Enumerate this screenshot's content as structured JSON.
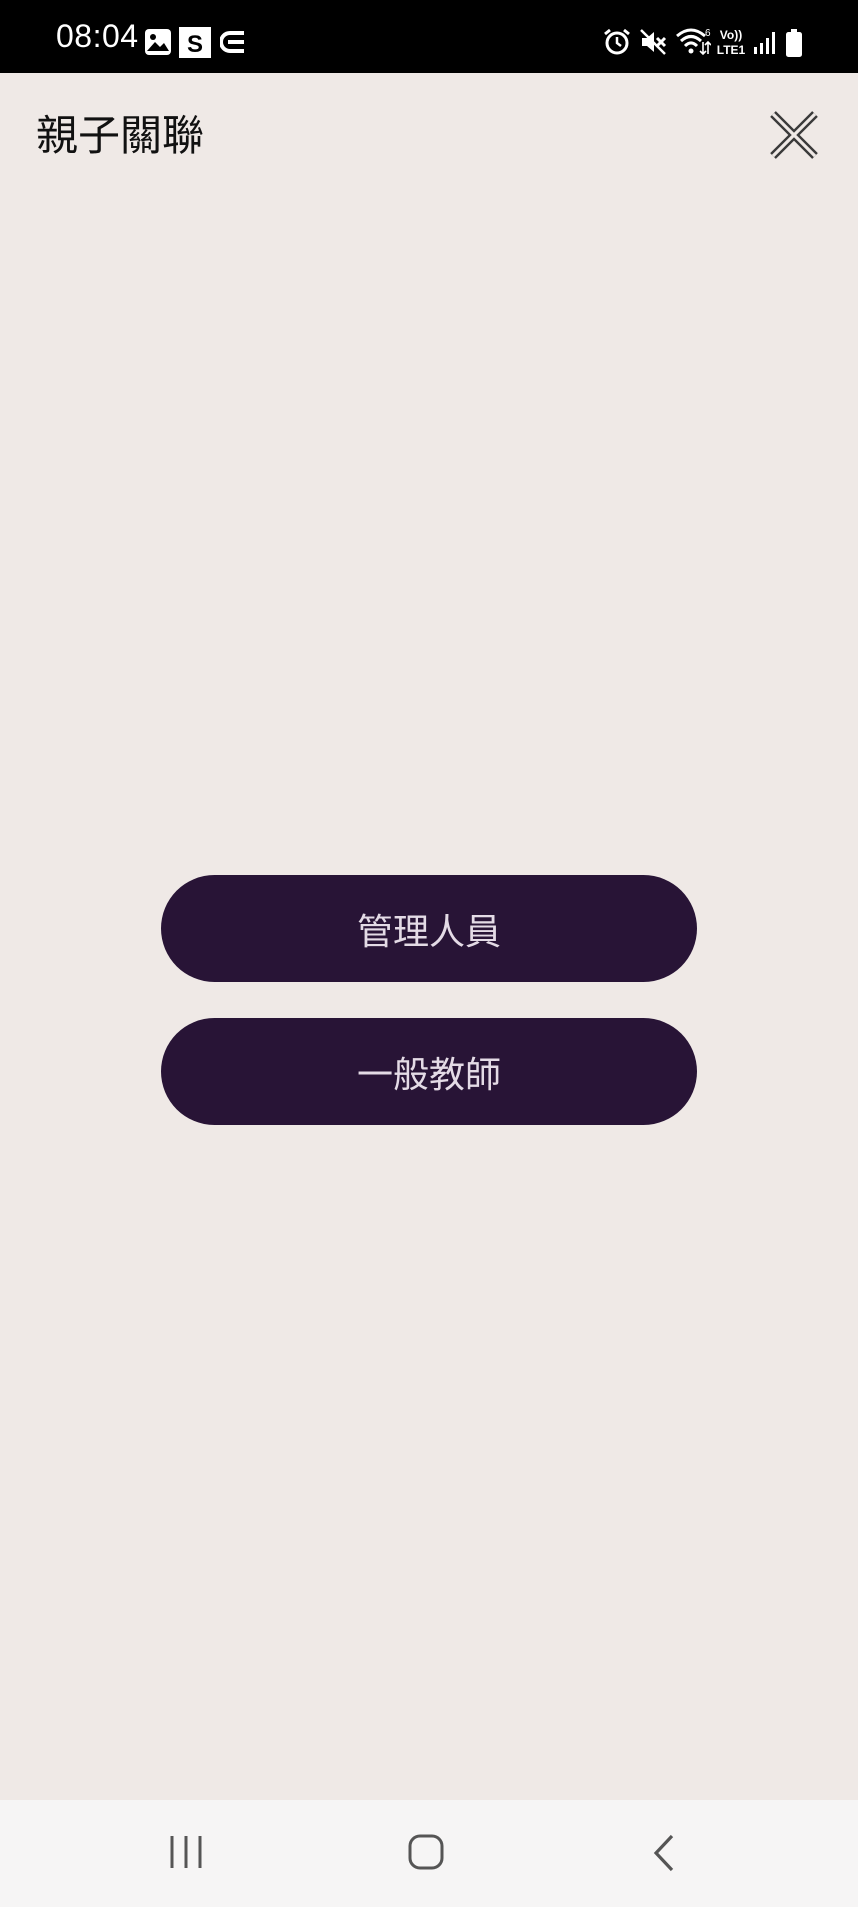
{
  "status_bar": {
    "time": "08:04",
    "left_icons": [
      "image-icon",
      "s-app-icon",
      "e-app-icon"
    ],
    "right_icons": [
      "alarm-icon",
      "mute-icon",
      "wifi-icon",
      "volte-lte-icon",
      "signal-icon",
      "battery-icon"
    ]
  },
  "header": {
    "title": "親子關聯"
  },
  "roles": [
    {
      "label": "管理人員"
    },
    {
      "label": "一般教師"
    }
  ],
  "nav_bar": {
    "buttons": [
      "recent-apps",
      "home",
      "back"
    ]
  },
  "colors": {
    "status_bar_bg": "#000000",
    "page_bg": "#efe9e6",
    "button_bg": "#281436",
    "button_text": "#e4dbe6",
    "nav_bar_bg": "#f6f5f5"
  }
}
